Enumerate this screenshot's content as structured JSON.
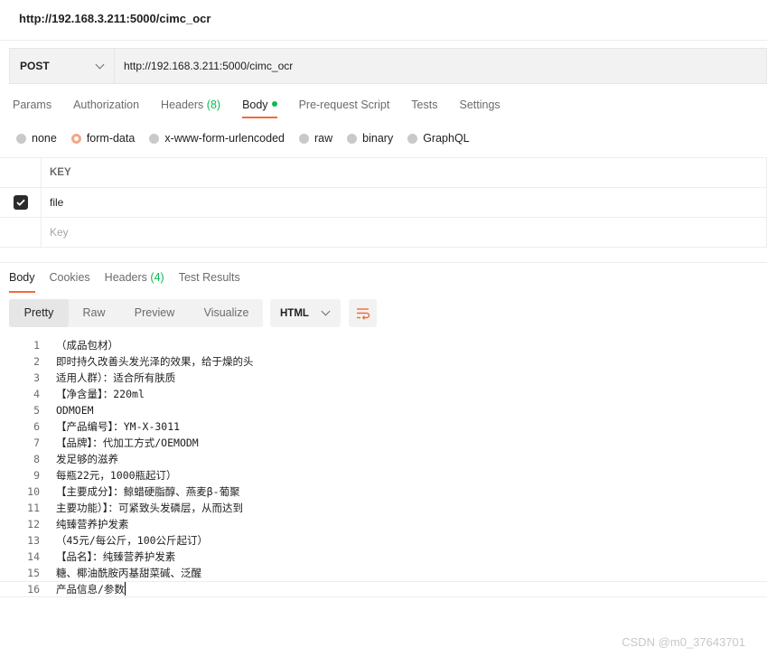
{
  "window": {
    "title": "http://192.168.3.211:5000/cimc_ocr"
  },
  "request": {
    "method": "POST",
    "url": "http://192.168.3.211:5000/cimc_ocr",
    "tabs": [
      {
        "label": "Params"
      },
      {
        "label": "Authorization"
      },
      {
        "label": "Headers",
        "count": "(8)"
      },
      {
        "label": "Body"
      },
      {
        "label": "Pre-request Script"
      },
      {
        "label": "Tests"
      },
      {
        "label": "Settings"
      }
    ],
    "active_tab": "Body",
    "body_types": [
      "none",
      "form-data",
      "x-www-form-urlencoded",
      "raw",
      "binary",
      "GraphQL"
    ],
    "selected_body_type": "form-data",
    "table": {
      "header": "KEY",
      "rows": [
        {
          "key": "file",
          "checked": true
        }
      ],
      "placeholder": "Key"
    }
  },
  "response": {
    "tabs": [
      {
        "label": "Body"
      },
      {
        "label": "Cookies"
      },
      {
        "label": "Headers",
        "count": "(4)"
      },
      {
        "label": "Test Results"
      }
    ],
    "active_tab": "Body",
    "view_modes": [
      "Pretty",
      "Raw",
      "Preview",
      "Visualize"
    ],
    "active_view": "Pretty",
    "format": "HTML",
    "lines": [
      "（成品包材）",
      "即时持久改善头发光泽的效果，给于燥的头",
      "适用人群）：适合所有肤质",
      "【净含量】：220ml",
      "ODMOEM",
      "【产品编号】：YM-X-3011",
      "【品牌】：代加工方式/OEMODM",
      "发足够的滋养",
      "每瓶22元，1000瓶起订）",
      "【主要成分】：鲸蜡硬脂醇、燕麦β-葡聚",
      "主要功能）】：可紧致头发磷层，从而达到",
      "纯臻营养护发素",
      "（45元/每公斤，100公斤起订）",
      "【品名】：纯臻营养护发素",
      "糖、椰油酰胺丙基甜菜碱、泛醒",
      "产品信息/参数"
    ]
  },
  "watermark": "CSDN @m0_37643701",
  "colors": {
    "accent": "#f26b3a",
    "green": "#0cbb52",
    "panel": "#f2f2f2"
  }
}
